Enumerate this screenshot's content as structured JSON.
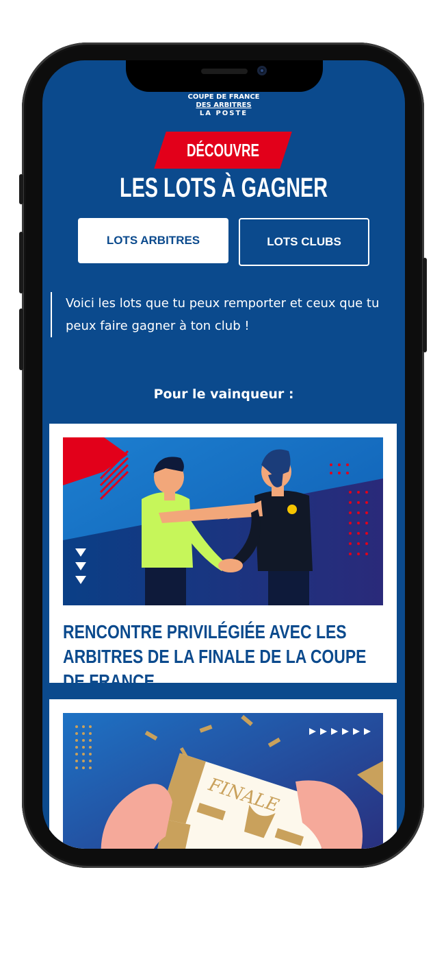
{
  "logo": {
    "line1": "COUPE DE FRANCE",
    "line2": "DES ARBITRES",
    "line3": "LA POSTE"
  },
  "hero": {
    "kicker": "DÉCOUVRE",
    "title": "LES LOTS À GAGNER"
  },
  "tabs": [
    {
      "label": "LOTS ARBITRES",
      "active": true
    },
    {
      "label": "LOTS CLUBS",
      "active": false
    }
  ],
  "intro": "Voici les lots que tu peux remporter et ceux que tu peux faire gagner à ton club !",
  "section_title": "Pour le vainqueur :",
  "cards": [
    {
      "title": "RENCONTRE PRIVILÉGIÉE AVEC LES ARBITRES DE LA FINALE DE LA COUPE DE FRANCE"
    },
    {
      "title": ""
    }
  ],
  "ticket_text": "FINALE",
  "colors": {
    "brand_blue": "#0b4a8d",
    "accent_red": "#e2001a",
    "gold": "#b08a4e",
    "light_green": "#c6f65a"
  }
}
